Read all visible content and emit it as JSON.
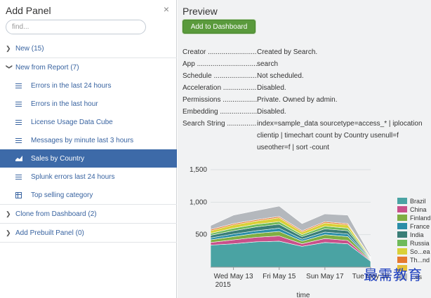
{
  "left": {
    "title": "Add Panel",
    "close": "×",
    "search_placeholder": "find...",
    "groups": [
      {
        "label": "New (15)",
        "expanded": false
      },
      {
        "label": "New from Report (7)",
        "expanded": true,
        "items": [
          {
            "label": "Errors in the last 24 hours",
            "icon": "list-icon",
            "selected": false
          },
          {
            "label": "Errors in the last hour",
            "icon": "list-icon",
            "selected": false
          },
          {
            "label": "License Usage Data Cube",
            "icon": "list-icon",
            "selected": false
          },
          {
            "label": "Messages by minute last 3 hours",
            "icon": "list-icon",
            "selected": false
          },
          {
            "label": "Sales by Country",
            "icon": "area-chart-icon",
            "selected": true
          },
          {
            "label": "Splunk errors last 24 hours",
            "icon": "list-icon",
            "selected": false
          },
          {
            "label": "Top selling category",
            "icon": "table-icon",
            "selected": false
          }
        ]
      },
      {
        "label": "Clone from Dashboard (2)",
        "expanded": false
      },
      {
        "label": "Add Prebuilt Panel (0)",
        "expanded": false
      }
    ]
  },
  "preview": {
    "title": "Preview",
    "add_button": "Add to Dashboard",
    "props": [
      {
        "key": "Creator ...............................",
        "value": "Created by Search."
      },
      {
        "key": "App .....................................",
        "value": "search"
      },
      {
        "key": "Schedule .............................",
        "value": "Not scheduled."
      },
      {
        "key": "Acceleration .......................",
        "value": "Disabled."
      },
      {
        "key": "Permissions ........................",
        "value": "Private. Owned by admin."
      },
      {
        "key": "Embedding ..........................",
        "value": "Disabled."
      },
      {
        "key": "Search String ...................",
        "value": "index=sample_data sourcetype=access_* | iplocation clientip | timechart count by Country usenull=f useother=f | sort -count"
      }
    ]
  },
  "chart_data": {
    "type": "area",
    "stacked": true,
    "xlabel": "time",
    "ylabel": "",
    "ylim": [
      0,
      1500
    ],
    "yticks": [
      500,
      1000,
      1500
    ],
    "ytick_labels": [
      "500",
      "1,000",
      "1,500"
    ],
    "x": [
      "2015-05-12",
      "2015-05-13",
      "2015-05-14",
      "2015-05-15",
      "2015-05-16",
      "2015-05-17",
      "2015-05-18",
      "2015-05-19"
    ],
    "xtick_labels": [
      "Wed May 13",
      "Fri May 15",
      "Sun May 17",
      "Tue May 19"
    ],
    "xtick_indices": [
      1,
      3,
      5,
      7
    ],
    "xtick_sublabel": "2015",
    "legend_position": "right",
    "series": [
      {
        "name": "Brazil",
        "color": "#4aa3a3",
        "values": [
          340,
          360,
          390,
          400,
          320,
          380,
          360,
          90
        ]
      },
      {
        "name": "China",
        "color": "#c9508a",
        "values": [
          40,
          60,
          70,
          80,
          40,
          60,
          50,
          10
        ]
      },
      {
        "name": "Finland",
        "color": "#7fae42",
        "values": [
          40,
          50,
          60,
          70,
          40,
          60,
          60,
          10
        ]
      },
      {
        "name": "France",
        "color": "#2b8ea8",
        "values": [
          30,
          40,
          40,
          50,
          30,
          40,
          40,
          10
        ]
      },
      {
        "name": "India",
        "color": "#3a7e77",
        "values": [
          40,
          50,
          60,
          60,
          40,
          50,
          50,
          10
        ]
      },
      {
        "name": "Russia",
        "color": "#6fba5a",
        "values": [
          30,
          40,
          40,
          40,
          30,
          40,
          40,
          10
        ]
      },
      {
        "name": "So...ea",
        "color": "#d9d038",
        "values": [
          40,
          50,
          50,
          60,
          40,
          50,
          50,
          10
        ]
      },
      {
        "name": "Th...nd",
        "color": "#e6782f",
        "values": [
          20,
          20,
          20,
          20,
          20,
          20,
          20,
          5
        ]
      },
      {
        "name": "",
        "color": "#e6c037",
        "values": [
          0,
          0,
          0,
          0,
          0,
          0,
          0,
          0
        ]
      },
      {
        "name": "...es",
        "color": "#b4b8bd",
        "values": [
          60,
          130,
          140,
          160,
          110,
          120,
          130,
          20
        ]
      }
    ]
  },
  "watermark": "最需教育"
}
